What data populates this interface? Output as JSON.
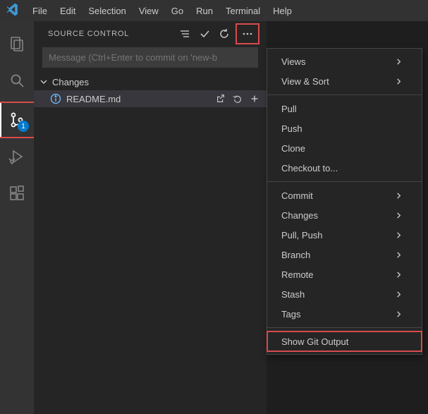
{
  "menubar": {
    "items": [
      "File",
      "Edit",
      "Selection",
      "View",
      "Go",
      "Run",
      "Terminal",
      "Help"
    ]
  },
  "activitybar": {
    "scm_badge": "1"
  },
  "sidepanel": {
    "title": "SOURCE CONTROL",
    "message_placeholder": "Message (Ctrl+Enter to commit on 'new-b",
    "changes_label": "Changes",
    "files": [
      {
        "name": "README.md"
      }
    ]
  },
  "context_menu": {
    "group1": [
      {
        "label": "Views",
        "submenu": true
      },
      {
        "label": "View & Sort",
        "submenu": true
      }
    ],
    "group2": [
      {
        "label": "Pull",
        "submenu": false
      },
      {
        "label": "Push",
        "submenu": false
      },
      {
        "label": "Clone",
        "submenu": false
      },
      {
        "label": "Checkout to...",
        "submenu": false
      }
    ],
    "group3": [
      {
        "label": "Commit",
        "submenu": true
      },
      {
        "label": "Changes",
        "submenu": true
      },
      {
        "label": "Pull, Push",
        "submenu": true
      },
      {
        "label": "Branch",
        "submenu": true
      },
      {
        "label": "Remote",
        "submenu": true
      },
      {
        "label": "Stash",
        "submenu": true
      },
      {
        "label": "Tags",
        "submenu": true
      }
    ],
    "group4": [
      {
        "label": "Show Git Output",
        "submenu": false,
        "highlight": true
      }
    ]
  }
}
